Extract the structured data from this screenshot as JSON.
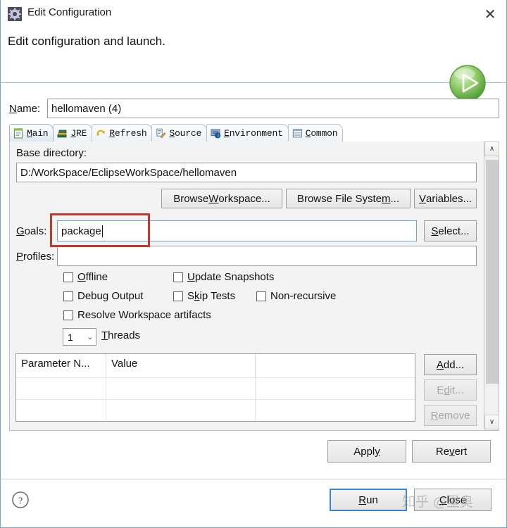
{
  "window": {
    "title": "Edit Configuration",
    "title_icon": "gear-icon",
    "close_label": "✕"
  },
  "header": {
    "message": "Edit configuration and launch.",
    "badge_icon": "green-run-play-icon"
  },
  "name_row": {
    "label_pre": "N",
    "label_accel": "N",
    "label": "Name:",
    "value": "hellomaven (4)",
    "placeholder": ""
  },
  "tabs": [
    {
      "label": "Main",
      "accel": "M",
      "icon": "main-document-icon",
      "active": true
    },
    {
      "label": "JRE",
      "accel": "J",
      "icon": "jre-books-icon",
      "active": false
    },
    {
      "label": "Refresh",
      "accel": "R",
      "icon": "refresh-arrows-icon",
      "active": false
    },
    {
      "label": "Source",
      "accel": "S",
      "icon": "source-edit-icon",
      "active": false
    },
    {
      "label": "Environment",
      "accel": "E",
      "icon": "environment-monitor-icon",
      "active": false
    },
    {
      "label": "Common",
      "accel": "C",
      "icon": "common-list-icon",
      "active": false
    }
  ],
  "main_tab": {
    "base_directory": {
      "label": "Base directory:",
      "value": "D:/WorkSpace/EclipseWorkSpace/hellomaven",
      "placeholder": ""
    },
    "dir_buttons": [
      {
        "label": "Browse Workspace...",
        "accel": "W",
        "name": "browse-workspace-button",
        "enabled": true
      },
      {
        "label": "Browse File System...",
        "accel": "m",
        "name": "browse-file-system-button",
        "enabled": true
      },
      {
        "label": "Variables...",
        "accel": "V",
        "name": "variables-button",
        "enabled": true
      }
    ],
    "goals": {
      "label": "Goals:",
      "accel": "G",
      "value": "package",
      "placeholder": "",
      "select_button": "Select...",
      "select_accel": "S",
      "highlighted": true
    },
    "profiles": {
      "label": "Profiles:",
      "accel": "P",
      "value": "",
      "placeholder": ""
    },
    "checkboxes": [
      {
        "label": "Offline",
        "accel": "O",
        "checked": false,
        "name": "checkbox-offline"
      },
      {
        "label": "Update Snapshots",
        "accel": "U",
        "checked": false,
        "name": "checkbox-update-snapshots"
      },
      {
        "label": "Debug Output",
        "accel": "g",
        "checked": false,
        "name": "checkbox-debug-output"
      },
      {
        "label": "Skip Tests",
        "accel": "k",
        "checked": false,
        "name": "checkbox-skip-tests"
      },
      {
        "label": "Non-recursive",
        "accel": "",
        "checked": false,
        "name": "checkbox-non-recursive"
      },
      {
        "label": "Resolve Workspace artifacts",
        "accel": "",
        "checked": false,
        "name": "checkbox-resolve-workspace-artifacts"
      }
    ],
    "threads": {
      "value": "1",
      "label": "Threads",
      "accel": "T",
      "chevron": "⌄",
      "options": [
        "1"
      ]
    },
    "parameters_table": {
      "columns": [
        "Parameter N...",
        "Value",
        ""
      ],
      "rows": [],
      "empty_row_count": 3
    },
    "table_buttons": [
      {
        "label": "Add...",
        "accel": "A",
        "name": "add-parameter-button",
        "enabled": true
      },
      {
        "label": "Edit...",
        "accel": "d",
        "name": "edit-parameter-button",
        "enabled": false
      },
      {
        "label": "Remove",
        "accel": "R",
        "name": "remove-parameter-button",
        "enabled": false
      }
    ]
  },
  "form_buttons": [
    {
      "label": "Apply",
      "accel": "y",
      "name": "apply-button"
    },
    {
      "label": "Revert",
      "accel": "v",
      "name": "revert-button"
    }
  ],
  "footer": {
    "help_icon": "help-question-icon",
    "run_label": "Run",
    "run_accel": "R",
    "close_label": "Close",
    "close_accel": "C"
  },
  "watermark": {
    "text": "知乎 @里奥"
  },
  "colors": {
    "accent_blue": "#3a86c8",
    "annotation_red": "#c0392b",
    "panel_bg": "#f3f3f3",
    "run_green": "#6cbf4a"
  },
  "scrollbar": {
    "up_arrow": "∧",
    "down_arrow": "∨"
  }
}
